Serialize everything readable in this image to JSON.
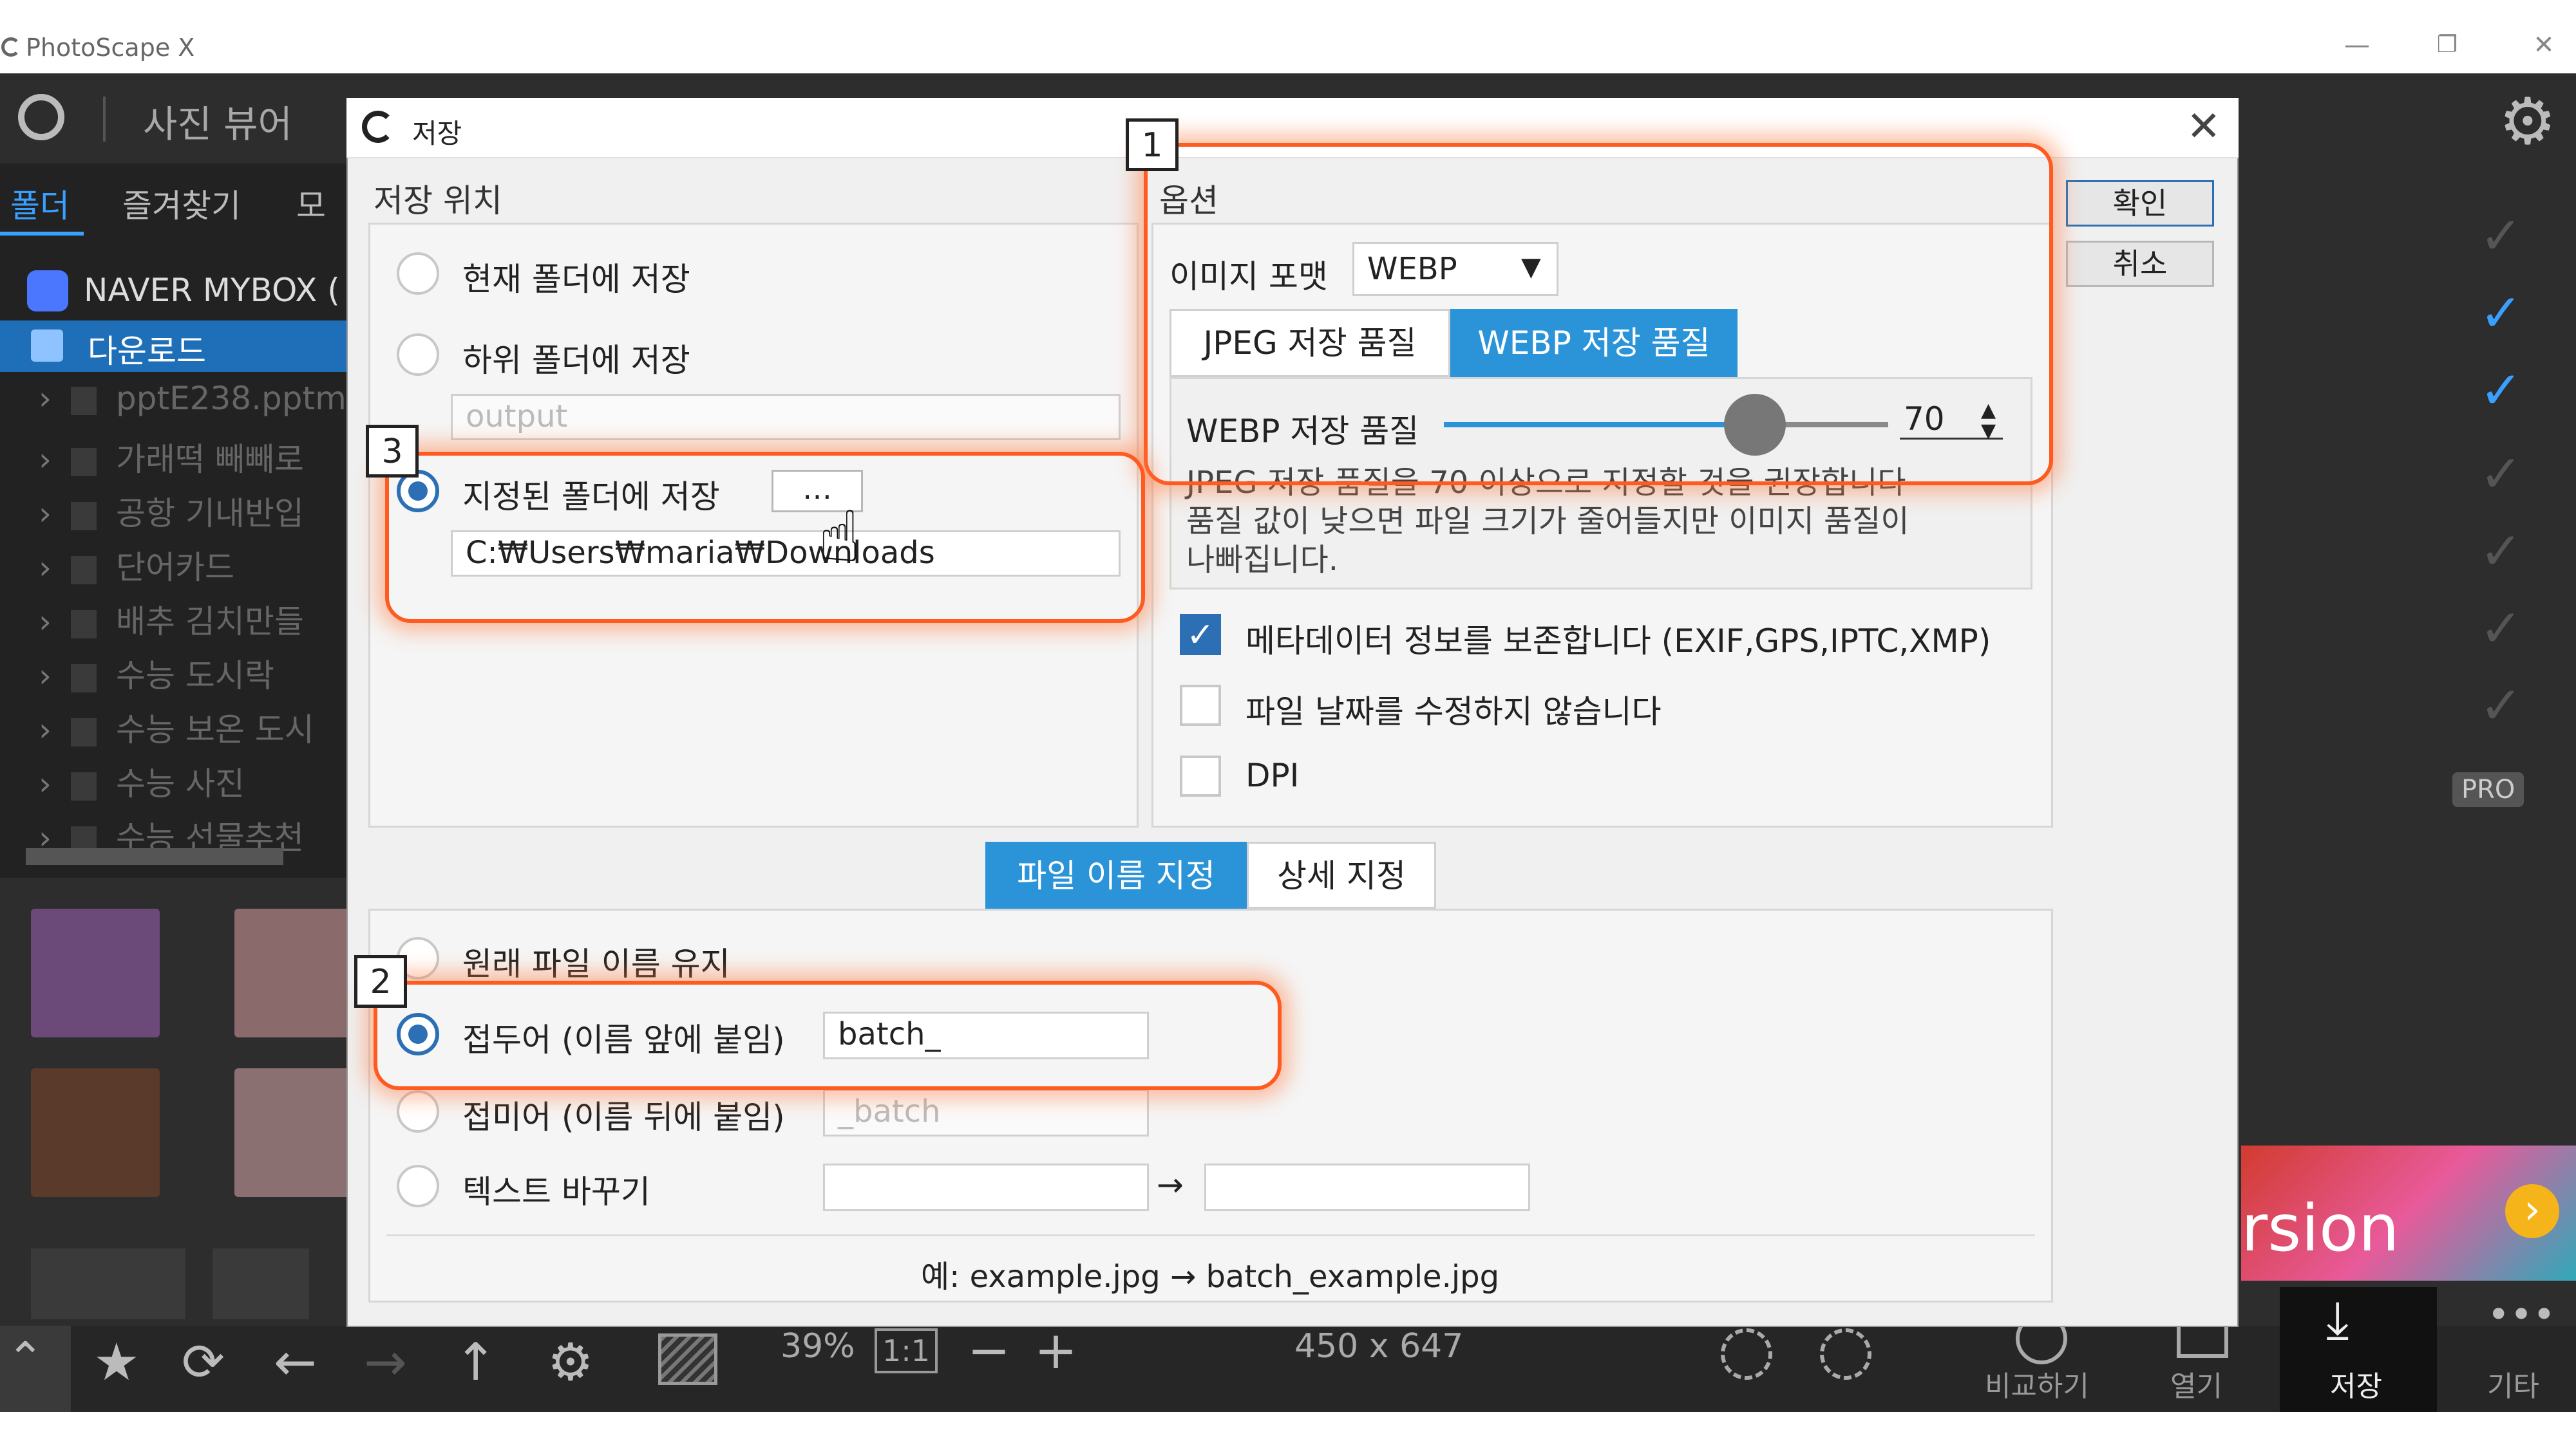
{
  "app": {
    "title": "PhotoScape X",
    "viewer_label": "사진 뷰어",
    "left_tabs": [
      "폴더",
      "즐겨찾기",
      "모"
    ],
    "tree_header": "NAVER MYBOX (",
    "tree_selected": "다운로드",
    "tree_items": [
      "pptE238.pptm",
      "가래떡 빼빼로",
      "공항 기내반입",
      "단어카드",
      "배추 김치만들",
      "수능 도시락",
      "수능 보온 도시",
      "수능 사진",
      "수능 선물추천"
    ],
    "pro_badge": "PRO",
    "promo_text": "rsion"
  },
  "toolbar": {
    "zoom": "39%",
    "one_to_one": "1:1",
    "minus": "−",
    "plus": "+",
    "dimensions": "450 x 647",
    "compare_label": "비교하기",
    "open_label": "열기",
    "save_label": "저장",
    "more_label": "기타"
  },
  "dialog": {
    "title": "저장",
    "ok_label": "확인",
    "cancel_label": "취소",
    "location": {
      "label": "저장 위치",
      "option_current": "현재 폴더에 저장",
      "option_sub": "하위 폴더에 저장",
      "sub_placeholder": "output",
      "option_specified": "지정된 폴더에 저장",
      "browse_label": "…",
      "path": "C:₩Users₩maria₩Downloads"
    },
    "options": {
      "label": "옵션",
      "format_label": "이미지 포맷",
      "format_value": "WEBP",
      "tab_jpeg": "JPEG 저장 품질",
      "tab_webp": "WEBP 저장 품질",
      "quality_label": "WEBP 저장 품질",
      "quality_value": "70",
      "quality_fraction": 0.7,
      "hint_line1": "JPEG 저장 품질을 70 이상으로 지정할 것을 권장합니다",
      "hint_line2": "품질 값이 낮으면 파일 크기가 줄어들지만 이미지 품질이",
      "hint_line3": "나빠집니다.",
      "meta_label": "메타데이터 정보를 보존합니다 (EXIF,GPS,IPTC,XMP)",
      "date_label": "파일 날짜를 수정하지 않습니다",
      "dpi_label": "DPI"
    },
    "naming": {
      "tab_filename": "파일 이름 지정",
      "tab_detail": "상세 지정",
      "keep_original": "원래 파일 이름 유지",
      "prefix_label": "접두어 (이름 앞에 붙임)",
      "prefix_value": "batch_",
      "suffix_label": "접미어 (이름 뒤에 붙임)",
      "suffix_placeholder": "_batch",
      "replace_label": "텍스트 바꾸기",
      "arrow": "→",
      "example": "예: example.jpg → batch_example.jpg"
    },
    "annotations": [
      "1",
      "2",
      "3"
    ]
  }
}
